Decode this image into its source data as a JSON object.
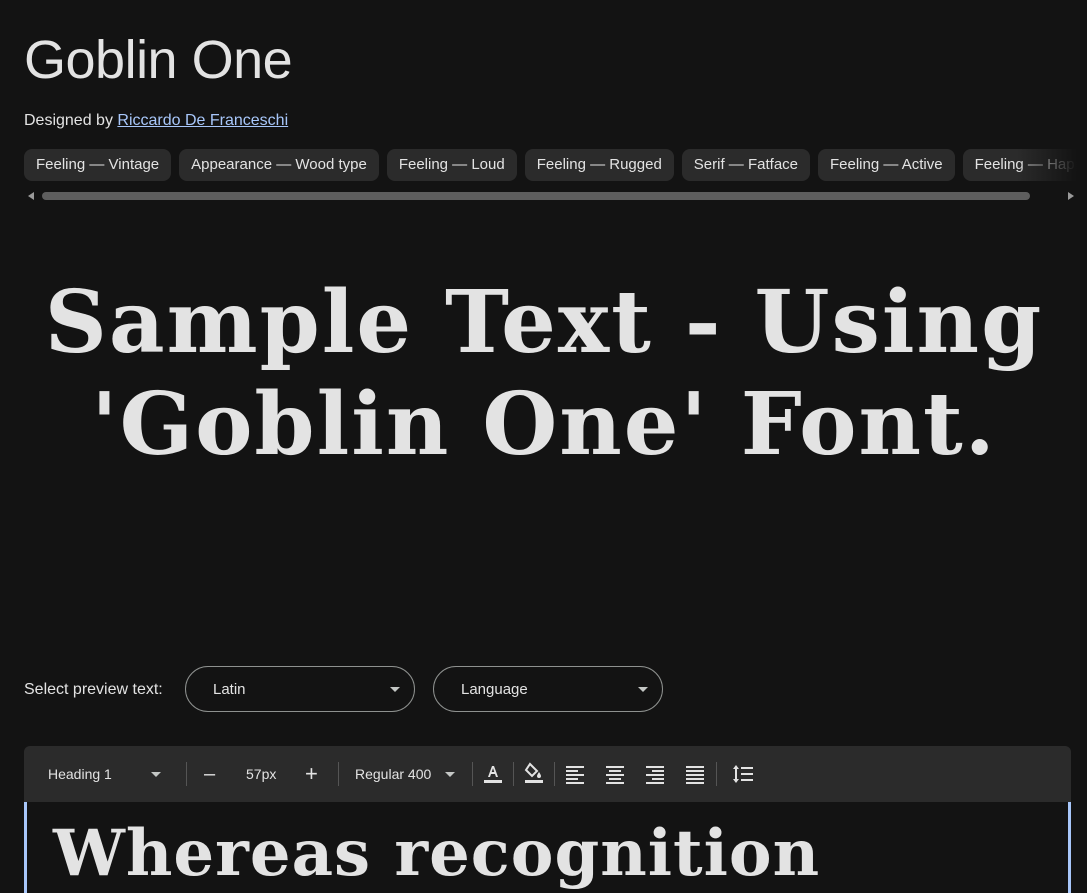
{
  "font": {
    "title": "Goblin One",
    "designed_by_label": "Designed by",
    "designer": "Riccardo De Franceschi"
  },
  "tags": [
    "Feeling — Vintage",
    "Appearance — Wood type",
    "Feeling — Loud",
    "Feeling — Rugged",
    "Serif — Fatface",
    "Feeling — Active",
    "Feeling — Happy"
  ],
  "sample_text": "Sample Text - Using 'Goblin One' Font.",
  "preview": {
    "label": "Select preview text:",
    "script_value": "Latin",
    "language_value": "Language"
  },
  "toolbar": {
    "style_value": "Heading 1",
    "decrease_label": "–",
    "size_value": "57px",
    "increase_label": "+",
    "weight_value": "Regular 400"
  },
  "editor_text": "Whereas recognition",
  "colors": {
    "background": "#131313",
    "surface": "#2b2b2b",
    "text": "#e3e3e3",
    "link": "#a8c7fa"
  }
}
